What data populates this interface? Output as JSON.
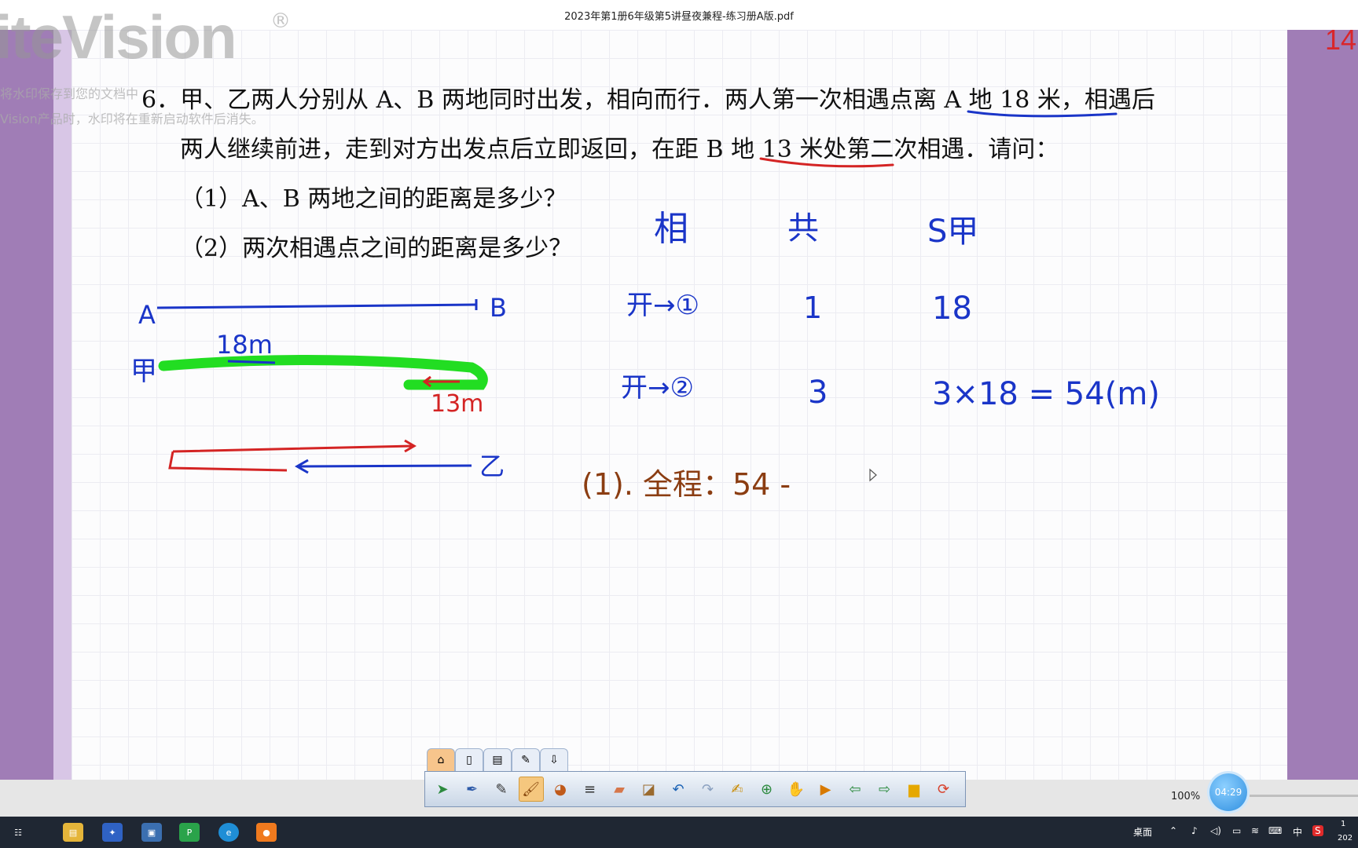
{
  "window": {
    "title": "2023年第1册6年级第5讲昼夜兼程-练习册A版.pdf"
  },
  "page_number": "14",
  "watermark": {
    "logo": "iteVision",
    "reg": "®",
    "line1": "将水印保存到您的文档中",
    "line2": "Vision产品时，水印将在重新启动软件后消失。"
  },
  "problem": {
    "line1": "6．甲、乙两人分别从 A、B 两地同时出发，相向而行．两人第一次相遇点离 A 地 18 米，相遇后",
    "line2": "两人继续前进，走到对方出发点后立即返回，在距 B 地 13 米处第二次相遇．请问：",
    "q1": "（1）A、B 两地之间的距离是多少？",
    "q2": "（2）两次相遇点之间的距离是多少？"
  },
  "handwriting": {
    "col_xiang": "相",
    "col_gong": "共",
    "col_s": "S甲",
    "row1_label": "开→①",
    "row1_gong": "1",
    "row1_s": "18",
    "row2_label": "开→②",
    "row2_gong": "3",
    "row2_s": "3×18 = 54(m)",
    "answer": "(1). 全程：54 -",
    "diagram_A": "A",
    "diagram_B": "B",
    "diagram_jia": "甲",
    "diagram_yi": "乙",
    "label_18m": "18m",
    "label_13m": "13m"
  },
  "toolbar": {
    "tabs": [
      "home-tab-icon",
      "page-tab-icon",
      "paste-tab-icon",
      "tools-tab-icon",
      "export-tab-icon"
    ],
    "buttons": [
      "select-arrow-icon",
      "pen-select-icon",
      "pen-icon",
      "brush-icon",
      "color-palette-icon",
      "line-style-icon",
      "eraser-icon",
      "clear-icon",
      "undo-icon",
      "redo-icon",
      "edit-note-icon",
      "new-page-icon",
      "hand-icon",
      "playback-icon",
      "prev-page-icon",
      "next-page-icon",
      "folder-icon",
      "refresh-icon"
    ]
  },
  "statusbar": {
    "zoom": "100%",
    "timer": "04:29"
  },
  "taskbar": {
    "desktop_label": "桌面",
    "ime_label": "中",
    "clock_time": "1",
    "clock_date": "202"
  }
}
